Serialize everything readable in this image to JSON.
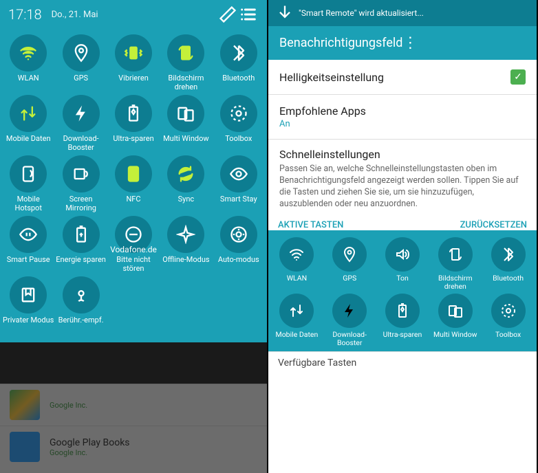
{
  "left": {
    "time": "17:18",
    "date": "Do., 21. Mai",
    "carrier": "Vodafone.de",
    "tiles": [
      {
        "label": "WLAN",
        "icon": "wifi",
        "active": true
      },
      {
        "label": "GPS",
        "icon": "location",
        "active": false
      },
      {
        "label": "Vibrieren",
        "icon": "vibrate",
        "active": true
      },
      {
        "label": "Bildschirm drehen",
        "icon": "rotate",
        "active": true
      },
      {
        "label": "Bluetooth",
        "icon": "bluetooth",
        "active": false
      },
      {
        "label": "Mobile Daten",
        "icon": "data",
        "active": true
      },
      {
        "label": "Download-Booster",
        "icon": "bolt",
        "active": false
      },
      {
        "label": "Ultra-sparen",
        "icon": "battery-ultra",
        "active": false
      },
      {
        "label": "Multi Window",
        "icon": "multiwindow",
        "active": false
      },
      {
        "label": "Toolbox",
        "icon": "toolbox",
        "active": false
      },
      {
        "label": "Mobile Hotspot",
        "icon": "hotspot",
        "active": false
      },
      {
        "label": "Screen Mirroring",
        "icon": "mirror",
        "active": false
      },
      {
        "label": "NFC",
        "icon": "nfc",
        "active": true
      },
      {
        "label": "Sync",
        "icon": "sync",
        "active": true
      },
      {
        "label": "Smart Stay",
        "icon": "eye",
        "active": false
      },
      {
        "label": "Smart Pause",
        "icon": "eye-pause",
        "active": false
      },
      {
        "label": "Energie sparen",
        "icon": "battery-save",
        "active": false
      },
      {
        "label": "Bitte nicht stören",
        "icon": "dnd",
        "active": false
      },
      {
        "label": "Offline-Modus",
        "icon": "airplane",
        "active": false
      },
      {
        "label": "Auto-modus",
        "icon": "car",
        "active": false
      },
      {
        "label": "Privater Modus",
        "icon": "private",
        "active": false
      },
      {
        "label": "Berühr.-empf.",
        "icon": "touch",
        "active": false
      }
    ],
    "bg_apps": [
      {
        "title": "",
        "vendor": "Google Inc."
      },
      {
        "title": "Google Play Books",
        "vendor": "Google Inc."
      }
    ]
  },
  "right": {
    "status_text": "\"Smart Remote\" wird aktualisiert...",
    "title": "Benachrichtigungsfeld",
    "brightness": {
      "title": "Helligkeitseinstellung",
      "checked": true
    },
    "recommended": {
      "title": "Empfohlene Apps",
      "sub": "An"
    },
    "quick": {
      "title": "Schnelleinstellungen",
      "desc": "Passen Sie an, welche Schnelleinstellungstasten oben im Benachrichtigungsfeld angezeigt werden sollen. Tippen Sie auf die Tasten und ziehen Sie sie, um sie hinzuzufügen, auszublenden oder neu anzuordnen."
    },
    "tabs": {
      "active": "AKTIVE TASTEN",
      "reset": "ZURÜCKSETZEN"
    },
    "tiles": [
      {
        "label": "WLAN",
        "icon": "wifi"
      },
      {
        "label": "GPS",
        "icon": "location"
      },
      {
        "label": "Ton",
        "icon": "sound"
      },
      {
        "label": "Bildschirm drehen",
        "icon": "rotate"
      },
      {
        "label": "Bluetooth",
        "icon": "bluetooth"
      },
      {
        "label": "Mobile Daten",
        "icon": "data"
      },
      {
        "label": "Download-Booster",
        "icon": "bolt"
      },
      {
        "label": "Ultra-sparen",
        "icon": "battery-ultra"
      },
      {
        "label": "Multi Window",
        "icon": "multiwindow"
      },
      {
        "label": "Toolbox",
        "icon": "toolbox"
      }
    ],
    "available": "Verfügbare Tasten"
  }
}
